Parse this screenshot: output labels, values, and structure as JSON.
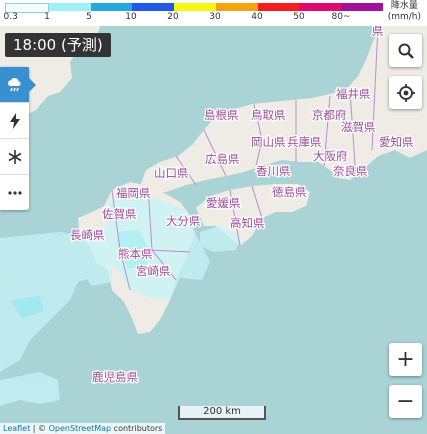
{
  "legend": {
    "colors": [
      "#f2ffff",
      "#a0f0f8",
      "#21a9e0",
      "#2158e8",
      "#f5f518",
      "#f5a210",
      "#f51e1e",
      "#e00a6e",
      "#a0129a"
    ],
    "ticks": [
      "0.3",
      "1",
      "5",
      "10",
      "20",
      "30",
      "40",
      "50",
      "80~"
    ],
    "unit_line1": "降水量",
    "unit_line2": "(mm/h)"
  },
  "time_label": "18:00 (予測)",
  "sidebar": [
    {
      "icon": "rain-cloud-icon",
      "active": true
    },
    {
      "icon": "lightning-icon",
      "active": false
    },
    {
      "icon": "snowflake-icon",
      "active": false
    },
    {
      "icon": "more-icon",
      "active": false
    }
  ],
  "controls": {
    "search": "search-icon",
    "locate": "locate-icon",
    "zoom_in": "+",
    "zoom_out": "−"
  },
  "scale_label": "200 km",
  "attribution": {
    "leaflet": "Leaflet",
    "sep": " | © ",
    "osm": "OpenStreetMap",
    "rest": " contributors"
  },
  "prefectures": [
    {
      "id": "fukui",
      "name": "福井県"
    },
    {
      "id": "shimane",
      "name": "島根県"
    },
    {
      "id": "tottori",
      "name": "鳥取県"
    },
    {
      "id": "kyoto",
      "name": "京都府"
    },
    {
      "id": "shiga",
      "name": "滋賀県"
    },
    {
      "id": "okayama",
      "name": "岡山県"
    },
    {
      "id": "hiroshima",
      "name": "広島県"
    },
    {
      "id": "hyogo",
      "name": "兵庫県"
    },
    {
      "id": "osaka",
      "name": "大阪府"
    },
    {
      "id": "aichi",
      "name": "愛知県"
    },
    {
      "id": "yamaguchi",
      "name": "山口県"
    },
    {
      "id": "kagawa",
      "name": "香川県"
    },
    {
      "id": "nara",
      "name": "奈良県"
    },
    {
      "id": "fukuoka",
      "name": "福岡県"
    },
    {
      "id": "tokushima",
      "name": "徳島県"
    },
    {
      "id": "ehime",
      "name": "愛媛県"
    },
    {
      "id": "saga",
      "name": "佐賀県"
    },
    {
      "id": "oita",
      "name": "大分県"
    },
    {
      "id": "kochi",
      "name": "高知県"
    },
    {
      "id": "nagasaki",
      "name": "長崎県"
    },
    {
      "id": "kumamoto",
      "name": "熊本県"
    },
    {
      "id": "miyazaki",
      "name": "宮崎県"
    },
    {
      "id": "kagoshima",
      "name": "鹿児島県"
    },
    {
      "id": "ishikawa",
      "name": "県"
    }
  ]
}
